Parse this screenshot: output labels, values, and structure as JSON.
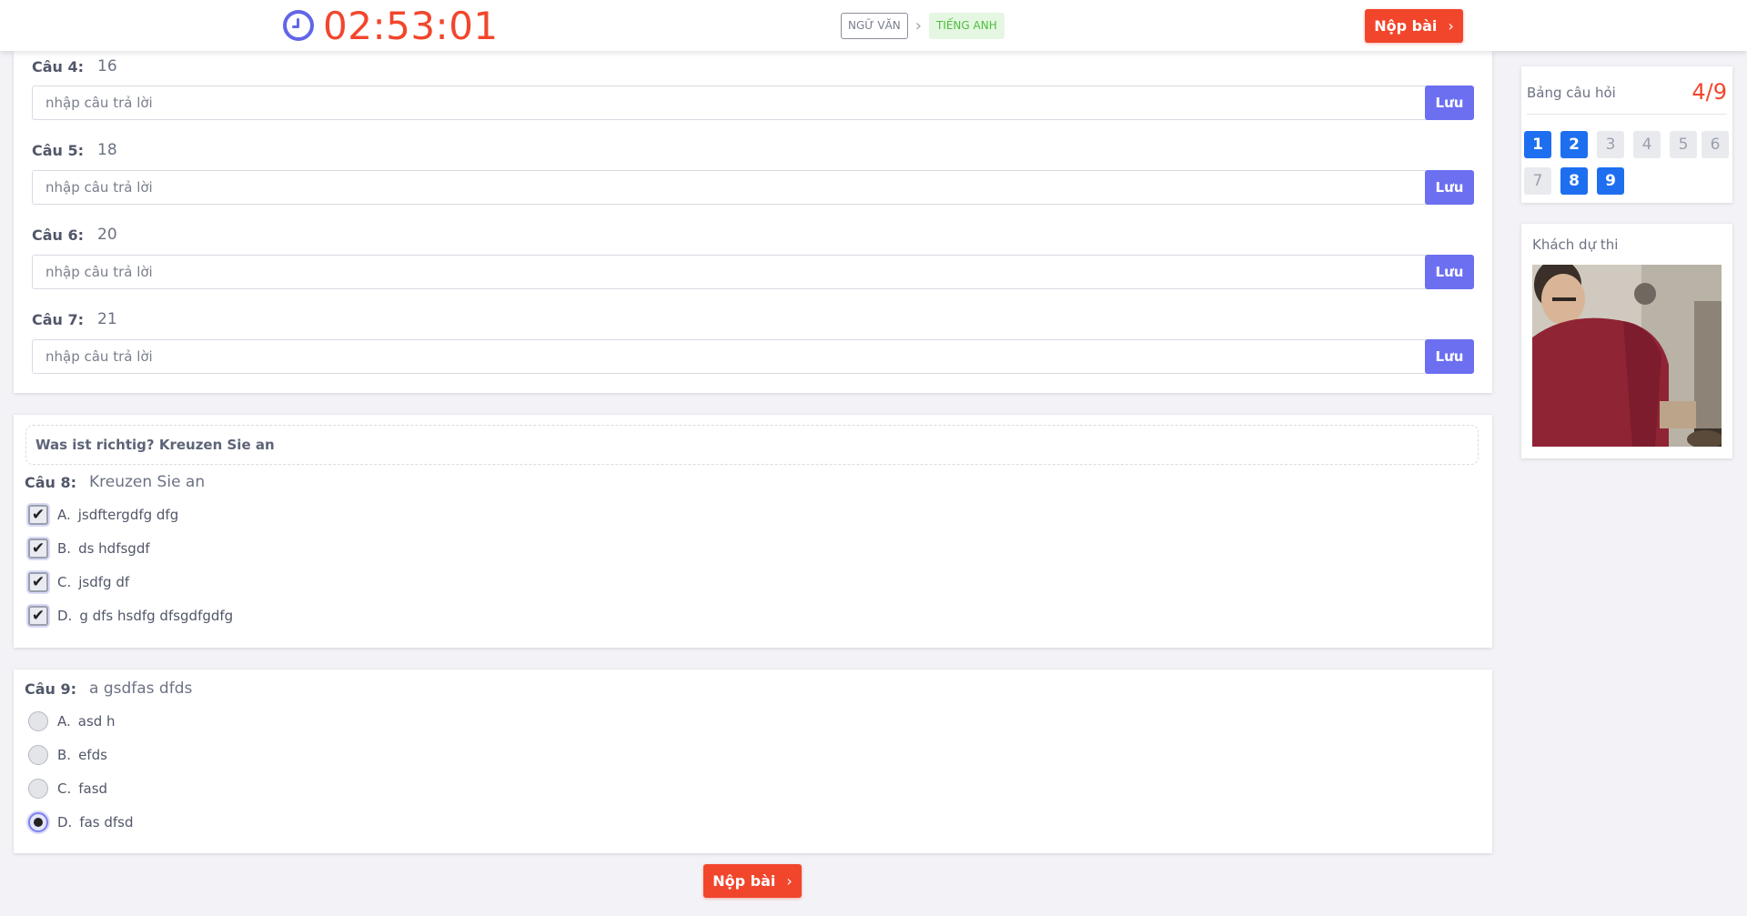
{
  "header": {
    "timer": "02:53:01",
    "subjects": [
      {
        "label": "Ngữ văn",
        "status": "done"
      },
      {
        "label": "Tiếng Anh",
        "status": "active"
      }
    ],
    "submit_label": "Nộp bài"
  },
  "open_questions": [
    {
      "label": "Câu 4:",
      "text": "16",
      "placeholder": "nhập câu trả lời",
      "save_label": "Lưu"
    },
    {
      "label": "Câu 5:",
      "text": "18",
      "placeholder": "nhập câu trả lời",
      "save_label": "Lưu"
    },
    {
      "label": "Câu 6:",
      "text": "20",
      "placeholder": "nhập câu trả lời",
      "save_label": "Lưu"
    },
    {
      "label": "Câu 7:",
      "text": "21",
      "placeholder": "nhập câu trả lời",
      "save_label": "Lưu"
    }
  ],
  "question8": {
    "instruction": "Was ist richtig? Kreuzen Sie an",
    "label": "Câu 8:",
    "text": "Kreuzen Sie an",
    "options": [
      {
        "letter": "A.",
        "text": "jsdftergdfg dfg",
        "checked": true
      },
      {
        "letter": "B.",
        "text": "ds hdfsgdf",
        "checked": true
      },
      {
        "letter": "C.",
        "text": "jsdfg df",
        "checked": true
      },
      {
        "letter": "D.",
        "text": "g dfs hsdfg dfsgdfgdfg",
        "checked": true
      }
    ]
  },
  "question9": {
    "label": "Câu 9:",
    "text": "a gsdfas dfds",
    "options": [
      {
        "letter": "A.",
        "text": "asd h",
        "checked": false
      },
      {
        "letter": "B.",
        "text": "efds",
        "checked": false
      },
      {
        "letter": "C.",
        "text": "fasd",
        "checked": false
      },
      {
        "letter": "D.",
        "text": "fas dfsd",
        "checked": true
      }
    ]
  },
  "footer": {
    "submit_label": "Nộp bài"
  },
  "question_board": {
    "title": "Bảng câu hỏi",
    "progress": "4/9",
    "numbers": [
      {
        "n": "1",
        "answered": true
      },
      {
        "n": "2",
        "answered": true
      },
      {
        "n": "3",
        "answered": false
      },
      {
        "n": "4",
        "answered": false
      },
      {
        "n": "5",
        "answered": false
      },
      {
        "n": "6",
        "answered": false
      },
      {
        "n": "7",
        "answered": false
      },
      {
        "n": "8",
        "answered": true
      },
      {
        "n": "9",
        "answered": true
      }
    ]
  },
  "candidate": {
    "title": "Khách dự thi"
  },
  "colors": {
    "accent_red": "#f1462c",
    "accent_purple": "#6b6ff0",
    "accent_blue": "#1e6ff0"
  }
}
